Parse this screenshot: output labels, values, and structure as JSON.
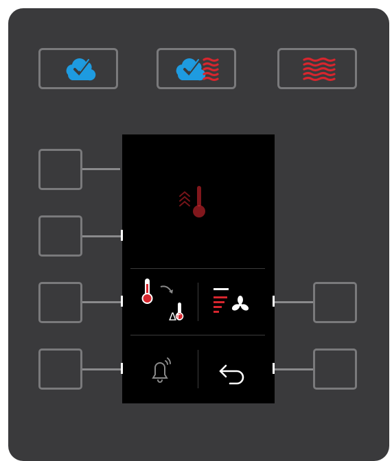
{
  "colors": {
    "panel": "#3a3a3c",
    "button_border": "#7a7a7c",
    "steam_blue": "#1e9be0",
    "heat_red": "#d7262e",
    "display_bg": "#000000",
    "icon_white": "#ffffff",
    "icon_grey": "#8a8a8a"
  },
  "mode_buttons": [
    {
      "icon": "steam-icon"
    },
    {
      "icon": "combi-steam-hot-air-icon"
    },
    {
      "icon": "hot-air-icon"
    }
  ],
  "display": {
    "main_icon": "core-temperature-rising-icon",
    "cells": [
      {
        "icon": "delta-t-temperature-icon"
      },
      {
        "icon": "fan-speed-icon"
      },
      {
        "icon": "bell-alarm-icon"
      },
      {
        "icon": "back-arrow-icon"
      }
    ]
  },
  "display_text": {
    "delta_label": "Δt"
  }
}
